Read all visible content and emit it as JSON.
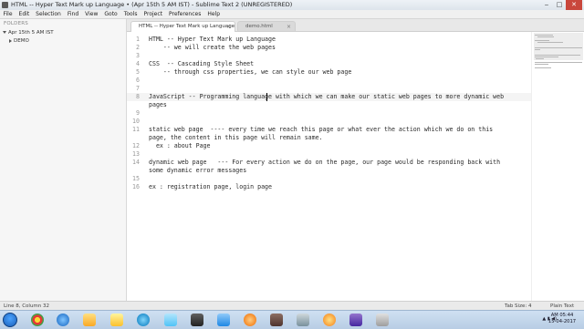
{
  "window": {
    "title": "HTML -- Hyper Text Mark up Language • (Apr 15th 5 AM IST) - Sublime Text 2 (UNREGISTERED)",
    "minimize": "‒",
    "maximize": "□",
    "close": "✕"
  },
  "menu": [
    "File",
    "Edit",
    "Selection",
    "Find",
    "View",
    "Goto",
    "Tools",
    "Project",
    "Preferences",
    "Help"
  ],
  "sidebar": {
    "title": "FOLDERS",
    "root_folder": "Apr 15th 5 AM IST",
    "child_folder": "DEMO"
  },
  "tabs": [
    {
      "label": "HTML -- Hyper Text Mark up Language",
      "close": "×",
      "active": true
    },
    {
      "label": "demo.html",
      "close": "×",
      "active": false
    }
  ],
  "editor": {
    "current_line": 8,
    "lines": [
      {
        "n": "1",
        "text": "HTML -- Hyper Text Mark up Language"
      },
      {
        "n": "2",
        "text": "    -- we will create the web pages"
      },
      {
        "n": "3",
        "text": ""
      },
      {
        "n": "4",
        "text": "CSS  -- Cascading Style Sheet"
      },
      {
        "n": "5",
        "text": "    -- through css properties, we can style our web page"
      },
      {
        "n": "6",
        "text": ""
      },
      {
        "n": "7",
        "text": ""
      },
      {
        "n": "8",
        "text": "JavaScript -- Programming language with which we can make our static web pages to more dynamic web"
      },
      {
        "n": "",
        "text": "pages"
      },
      {
        "n": "9",
        "text": ""
      },
      {
        "n": "10",
        "text": ""
      },
      {
        "n": "11",
        "text": "static web page  ---- every time we reach this page or what ever the action which we do on this"
      },
      {
        "n": "",
        "text": "page, the content in this page will remain same."
      },
      {
        "n": "12",
        "text": "  ex : about Page"
      },
      {
        "n": "13",
        "text": ""
      },
      {
        "n": "14",
        "text": "dynamic web page   --- For every action we do on the page, our page would be responding back with"
      },
      {
        "n": "",
        "text": "some dynamic error messages"
      },
      {
        "n": "15",
        "text": ""
      },
      {
        "n": "16",
        "text": "ex : registration page, login page"
      }
    ]
  },
  "status": {
    "position": "Line 8, Column 32",
    "tab_size": "Tab Size: 4",
    "syntax": "Plain Text"
  },
  "taskbar": {
    "icons": [
      "chrome-icon",
      "ie-icon",
      "explorer-icon",
      "player-icon",
      "paint-icon",
      "skype-icon",
      "sublime-icon",
      "tool-icon",
      "photo-icon",
      "firefox-icon",
      "lamp-icon",
      "settings-icon",
      "eclipse-icon",
      "game-icon",
      "terminal-icon"
    ],
    "time": "AM 05:44",
    "date": "15-04-2017"
  },
  "colors": {
    "accent": "#1b5fb8",
    "close_button": "#c9473c"
  }
}
